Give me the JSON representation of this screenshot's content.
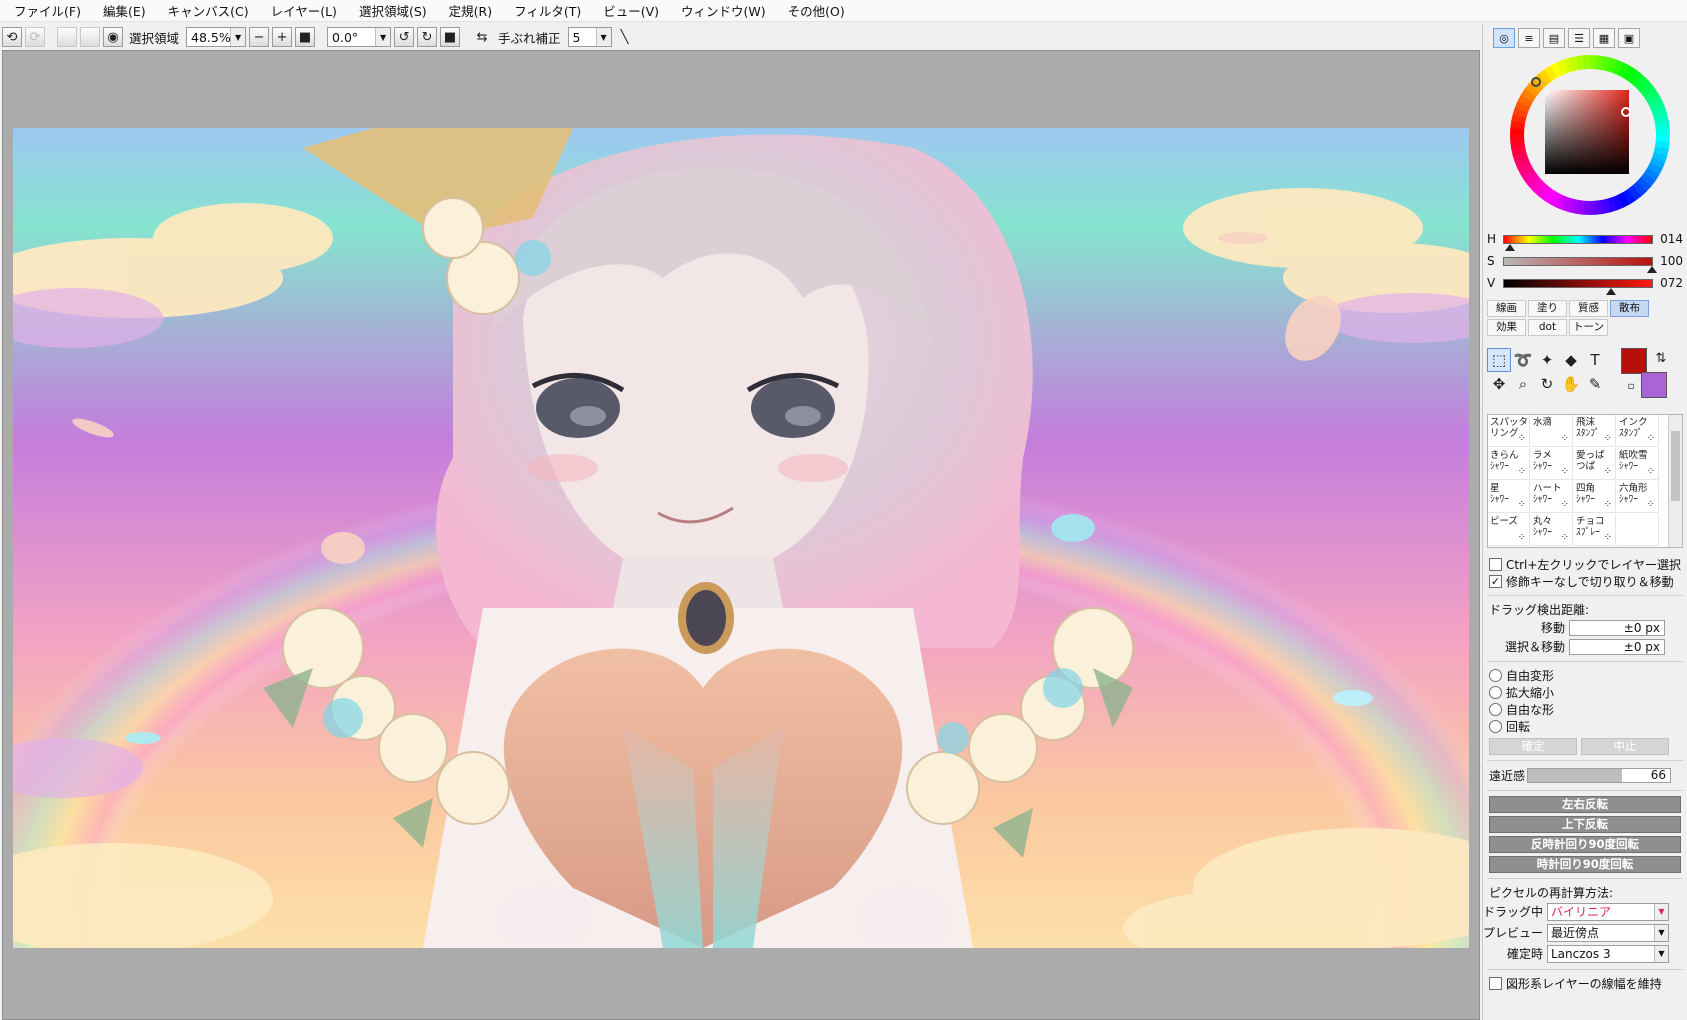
{
  "menu": [
    {
      "label": "ファイル(F)"
    },
    {
      "label": "編集(E)"
    },
    {
      "label": "キャンバス(C)"
    },
    {
      "label": "レイヤー(L)"
    },
    {
      "label": "選択領域(S)"
    },
    {
      "label": "定規(R)"
    },
    {
      "label": "フィルタ(T)"
    },
    {
      "label": "ビュー(V)"
    },
    {
      "label": "ウィンドウ(W)"
    },
    {
      "label": "その他(O)"
    }
  ],
  "toolbar": {
    "selection_label": "選択領域",
    "zoom_value": "48.5%",
    "rotation_value": "0.0°",
    "stabilizer_label": "手ぶれ補正",
    "stabilizer_value": "5"
  },
  "color": {
    "current": "#b80f0a",
    "secondary": "#a964d6",
    "h_label": "H",
    "h_value": "014",
    "h_fraction": 0.04,
    "s_label": "S",
    "s_value": "100",
    "s_fraction": 1.0,
    "v_label": "V",
    "v_value": "072",
    "v_fraction": 0.72
  },
  "brush_tabs": [
    {
      "label": "線画"
    },
    {
      "label": "塗り"
    },
    {
      "label": "質感"
    },
    {
      "label": "散布"
    },
    {
      "label": "効果"
    },
    {
      "label": "dot"
    },
    {
      "label": "トーン"
    }
  ],
  "active_brush_tab": "散布",
  "brushes": [
    {
      "l1": "スパッタ",
      "l2": "リング"
    },
    {
      "l1": "水滴",
      "l2": ""
    },
    {
      "l1": "飛沫",
      "l2": "ｽﾀﾝﾌﾟ"
    },
    {
      "l1": "インク",
      "l2": "ｽﾀﾝﾌﾟ"
    },
    {
      "l1": "きらん",
      "l2": "ｼｬﾜｰ"
    },
    {
      "l1": "ラメ",
      "l2": "ｼｬﾜｰ"
    },
    {
      "l1": "愛っぱ",
      "l2": "つぱ"
    },
    {
      "l1": "紙吹雪",
      "l2": "ｼｬﾜｰ"
    },
    {
      "l1": "星",
      "l2": "ｼｬﾜｰ"
    },
    {
      "l1": "ハート",
      "l2": "ｼｬﾜｰ"
    },
    {
      "l1": "四角",
      "l2": "ｼｬﾜｰ"
    },
    {
      "l1": "六角形",
      "l2": "ｼｬﾜｰ"
    },
    {
      "l1": "ビーズ",
      "l2": ""
    },
    {
      "l1": "丸々",
      "l2": "ｼｬﾜｰ"
    },
    {
      "l1": "チョコ",
      "l2": "ｽﾌﾟﾚｰ"
    },
    {
      "l1": "",
      "l2": ""
    }
  ],
  "options": {
    "ctrl_click": "Ctrl+左クリックでレイヤー選択",
    "no_modifier": "修飾キーなしで切り取り＆移動",
    "drag_distance_title": "ドラッグ検出距離:",
    "move_label": "移動",
    "move_value": "±0 px",
    "select_move_label": "選択＆移動",
    "select_move_value": "±0 px",
    "free_transform": "自由変形",
    "scale": "拡大縮小",
    "free_shape": "自由な形",
    "rotate": "回転",
    "confirm": "確定",
    "cancel": "中止",
    "perspective_label": "遠近感",
    "perspective_value": "66",
    "perspective_fraction": 0.66,
    "flip_h": "左右反転",
    "flip_v": "上下反転",
    "rot_ccw": "反時計回り90度回転",
    "rot_cw": "時計回り90度回転",
    "resample_title": "ピクセルの再計算方法:",
    "drag_label": "ドラッグ中",
    "drag_value": "バイリニア",
    "preview_label": "プレビュー",
    "preview_value": "最近傍点",
    "final_label": "確定時",
    "final_value": "Lanczos 3",
    "keep_stroke": "図形系レイヤーの線幅を維持"
  }
}
